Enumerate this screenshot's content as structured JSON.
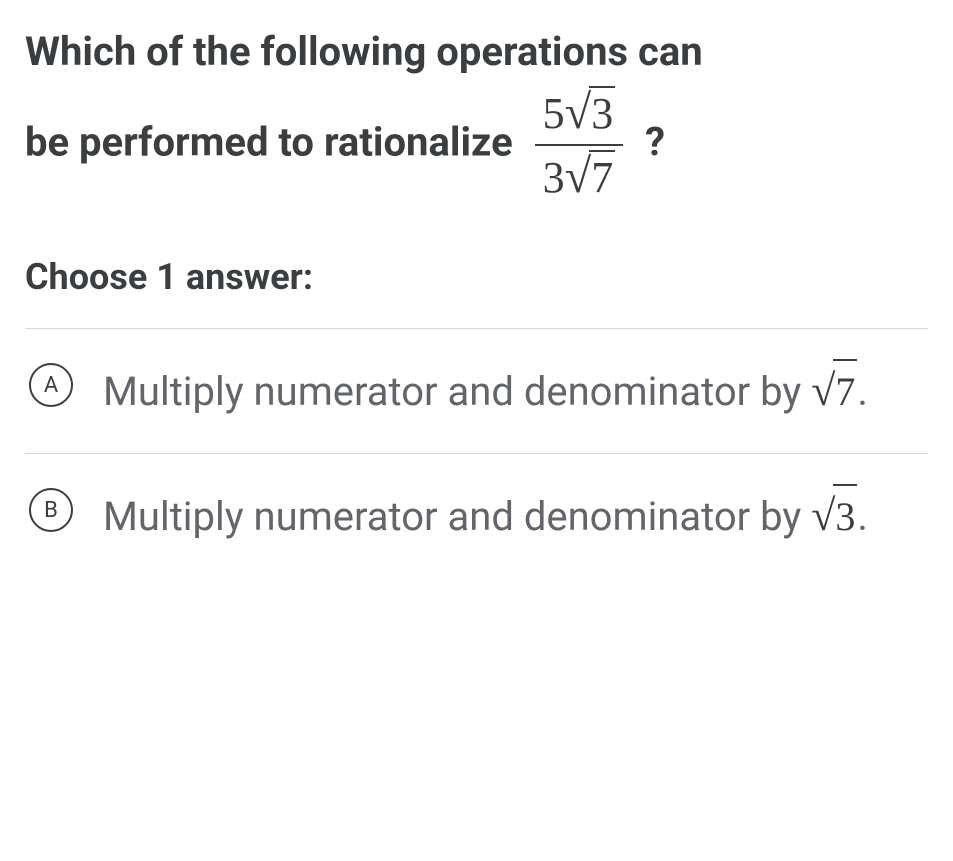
{
  "question": {
    "line1": "Which of the following operations can",
    "line2_prefix": "be performed to rationalize ",
    "fraction_num_coeff": "5",
    "fraction_num_rad": "3",
    "fraction_den_coeff": "3",
    "fraction_den_rad": "7",
    "line2_suffix": "?"
  },
  "instruction": "Choose 1 answer:",
  "options": [
    {
      "letter": "A",
      "text_prefix": "Multiply numerator and denominator by ",
      "radicand": "7",
      "text_suffix": "."
    },
    {
      "letter": "B",
      "text_prefix": "Multiply numerator and denominator by ",
      "radicand": "3",
      "text_suffix": "."
    }
  ]
}
